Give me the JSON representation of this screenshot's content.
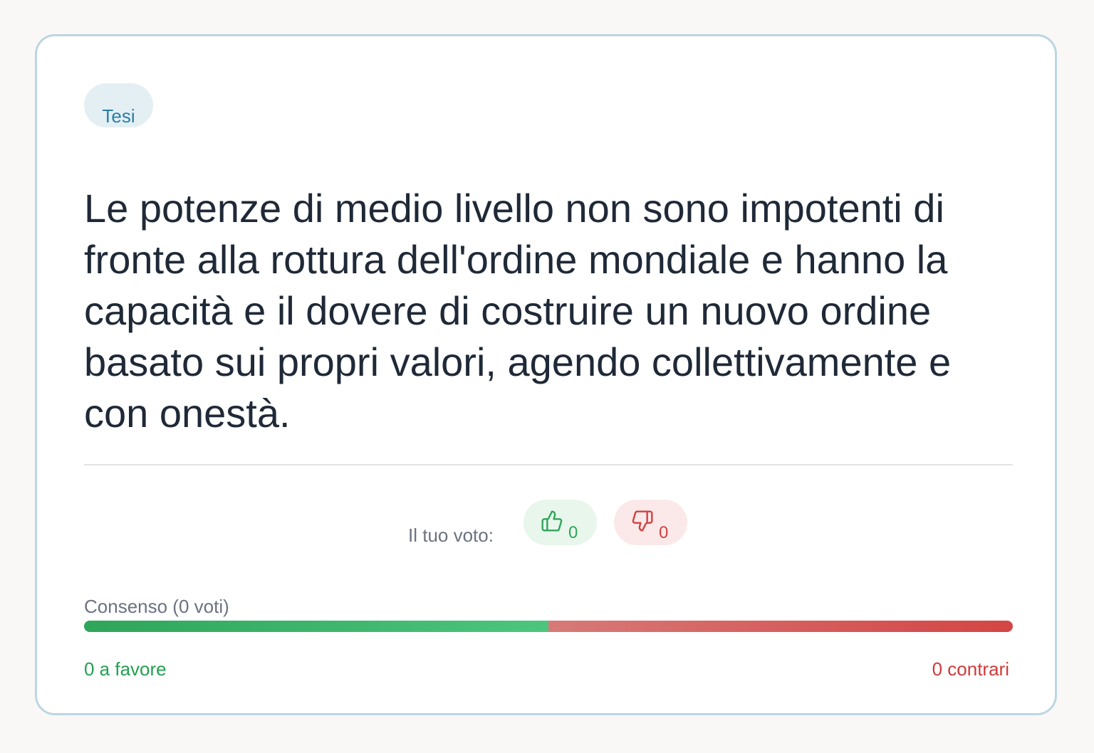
{
  "card": {
    "badge": "Tesi",
    "thesis": "Le potenze di medio livello non sono impotenti di fronte alla rottura dell'ordine mondiale e hanno la capacità e il dovere di costruire un nuovo ordine basato sui propri valori, agendo collettivamente e con onestà."
  },
  "vote": {
    "label": "Il tuo voto:",
    "up": {
      "icon": "thumbs-up-icon",
      "count": "0"
    },
    "down": {
      "icon": "thumbs-down-icon",
      "count": "0"
    }
  },
  "consensus": {
    "label": "Consenso (0 voti)",
    "pro_fraction": 0.5,
    "favor_text": "0 a favore",
    "against_text": "0 contrari"
  },
  "colors": {
    "accent": "#2a7ea7",
    "positive": "#2fa55a",
    "negative": "#d44040",
    "text": "#1f2937",
    "muted": "#6b7280"
  }
}
